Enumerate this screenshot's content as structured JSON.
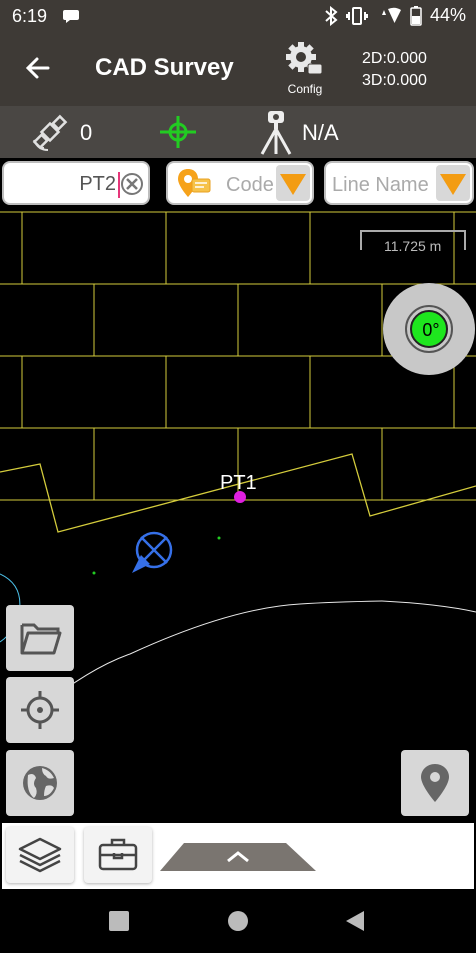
{
  "status_bar": {
    "time": "6:19",
    "battery": "44%"
  },
  "app_bar": {
    "title": "CAD Survey",
    "config_label": "Config",
    "readout_2d": "2D:0.000",
    "readout_3d": "3D:0.000"
  },
  "status_row": {
    "satellite_count": "0",
    "instrument_status": "N/A"
  },
  "inputs": {
    "point_name": "PT2",
    "code_placeholder": "Code",
    "line_name_placeholder": "Line Name"
  },
  "map": {
    "scale": "11.725 m",
    "compass_angle": "0°",
    "points": [
      {
        "label": "PT1"
      }
    ]
  },
  "colors": {
    "app_bar": "#3e3a36",
    "status_row": "#4a4744",
    "grid_lines": "#d4cc3c",
    "point_marker": "#e020e0",
    "compass_core": "#1ee61e",
    "dropdown_arrow": "#f39c12",
    "crosshair": "#22cc22"
  },
  "icons": {
    "back": "arrow-left-icon",
    "config": "gear-icon",
    "satellite": "satellite-icon",
    "crosshair": "crosshair-icon",
    "tripod": "tripod-icon",
    "clear": "clear-icon",
    "code": "location-tag-icon",
    "folder": "folder-icon",
    "locate": "target-icon",
    "globe": "globe-icon",
    "map_pin": "map-pin-icon",
    "layers": "layers-icon",
    "toolbox": "toolbox-icon",
    "expand": "chevron-up-icon"
  }
}
